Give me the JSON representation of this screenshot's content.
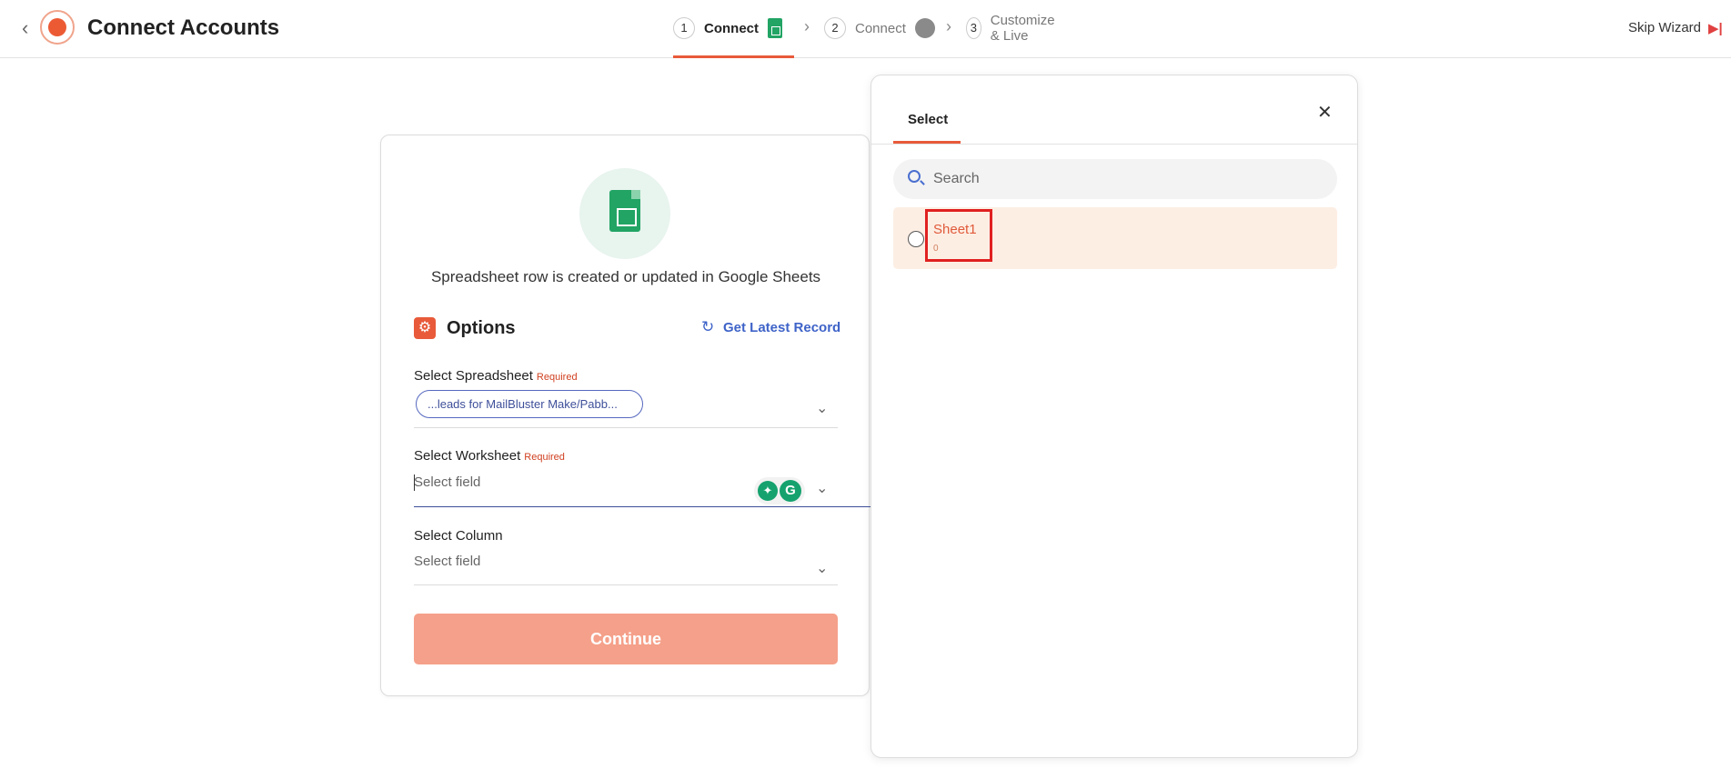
{
  "header": {
    "back_icon": "chevron-left-icon",
    "logo_icon": "plug-icon",
    "title": "Connect Accounts",
    "steps": [
      {
        "number": "1",
        "label": "Connect",
        "icon": "google-sheets-icon",
        "active": true
      },
      {
        "number": "2",
        "label": "Connect",
        "icon": "service-icon",
        "active": false
      },
      {
        "number": "3",
        "label": "Customize & Live",
        "active": false
      }
    ],
    "skip_label": "Skip Wizard",
    "skip_icon_glyph": "▶|"
  },
  "card": {
    "hero_icon": "google-sheets-icon",
    "description": "Spreadsheet row is created or updated in Google Sheets",
    "options_title": "Options",
    "options_icon_glyph": "⚙",
    "latest_icon_glyph": "↻",
    "latest_label": "Get Latest Record",
    "fields": {
      "spreadsheet": {
        "label": "Select Spreadsheet",
        "required": "Required",
        "chip": "...leads for MailBluster Make/Pabb..."
      },
      "worksheet": {
        "label": "Select Worksheet",
        "required": "Required",
        "placeholder": "Select field"
      },
      "column": {
        "label": "Select Column",
        "placeholder": "Select field"
      }
    },
    "grammarly_icons": [
      "grammarly-idea-icon",
      "grammarly-icon"
    ],
    "grammarly_glyphs": [
      "✦",
      "G"
    ],
    "dropdown_glyph": "⌄",
    "continue_label": "Continue",
    "continue_color": "#f5a08a"
  },
  "panel": {
    "tab_label": "Select",
    "close_glyph": "✕",
    "search_placeholder": "Search",
    "items": [
      {
        "name": "Sheet1",
        "sub": "0"
      }
    ]
  },
  "colors": {
    "accent": "#e85a3a",
    "link": "#3e63c8",
    "sheets_green": "#21a464"
  }
}
